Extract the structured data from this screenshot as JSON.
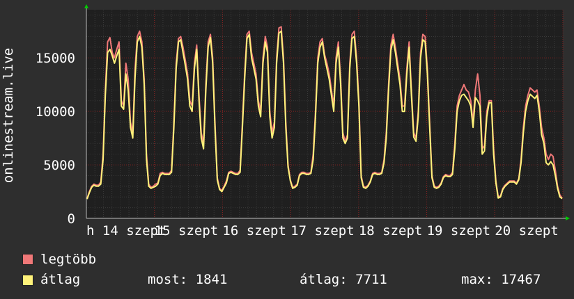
{
  "chart_data": {
    "type": "line",
    "ylabel": "onlinestream.live",
    "ylim": [
      0,
      19500
    ],
    "yticks": [
      0,
      5000,
      10000,
      15000
    ],
    "x_tick_labels": [
      "h 14 szept",
      "15 szept",
      "16 szept",
      "17 szept",
      "18 szept",
      "19 szept",
      "20 szept"
    ],
    "grid": true,
    "colors": {
      "background": "#2e2e2e",
      "plot": "#1f1f1f",
      "grid": "#3a3a3a",
      "major_grid": "#8a2020",
      "max": "#f07878",
      "avg": "#fff27a",
      "axis_arrow": "#00cc00"
    },
    "series": [
      {
        "name": "legtöbb",
        "color": "#f07878",
        "values": [
          1850,
          2500,
          3000,
          3200,
          3100,
          3100,
          3400,
          6000,
          12000,
          16500,
          16900,
          15500,
          15000,
          15800,
          16500,
          11000,
          10500,
          14500,
          13000,
          9000,
          8000,
          14000,
          17000,
          17500,
          16500,
          13000,
          6000,
          3200,
          2900,
          3000,
          3200,
          3300,
          4200,
          4300,
          4200,
          4200,
          4200,
          4500,
          9000,
          14500,
          16800,
          17000,
          16000,
          14800,
          13500,
          11000,
          10500,
          14500,
          16200,
          11500,
          8000,
          7000,
          12500,
          16500,
          17200,
          15000,
          9000,
          3800,
          2800,
          2600,
          3000,
          3500,
          4300,
          4400,
          4300,
          4200,
          4200,
          4500,
          9000,
          13500,
          17200,
          17500,
          15500,
          14500,
          13500,
          11000,
          10000,
          15000,
          17000,
          16000,
          10000,
          8000,
          9000,
          15000,
          17800,
          17900,
          15000,
          9000,
          5000,
          3600,
          2900,
          3000,
          3200,
          4100,
          4300,
          4300,
          4200,
          4200,
          4300,
          6000,
          10000,
          15000,
          16500,
          16800,
          15300,
          14500,
          13500,
          12000,
          10500,
          15000,
          16500,
          13000,
          8000,
          7200,
          7800,
          14500,
          17200,
          17500,
          15000,
          11000,
          4000,
          3000,
          2900,
          3100,
          3500,
          4200,
          4300,
          4200,
          4200,
          4300,
          5500,
          8000,
          12500,
          16200,
          17200,
          16000,
          14500,
          13000,
          10500,
          10500,
          14000,
          16500,
          12000,
          8000,
          7500,
          10000,
          15500,
          17200,
          17000,
          14000,
          9000,
          4000,
          3000,
          2900,
          3000,
          3300,
          3900,
          4100,
          4000,
          4000,
          4300,
          7000,
          10500,
          11500,
          12000,
          12500,
          12000,
          11800,
          11000,
          9000,
          12000,
          13500,
          11500,
          6500,
          6800,
          10000,
          11000,
          11000,
          6500,
          3500,
          2000,
          2100,
          2800,
          3100,
          3300,
          3500,
          3500,
          3500,
          3300,
          3700,
          5500,
          8500,
          10500,
          11500,
          12200,
          12000,
          11800,
          12000,
          10500,
          8500,
          7500,
          6000,
          5500,
          6000,
          5800,
          4500,
          3000,
          2200,
          1900
        ],
        "linewidth": 2
      },
      {
        "name": "átlag",
        "color": "#fff27a",
        "values": [
          1800,
          2400,
          2900,
          3100,
          3000,
          3000,
          3200,
          5500,
          11500,
          15500,
          15800,
          15200,
          14500,
          15200,
          15800,
          10500,
          10200,
          13500,
          12000,
          8500,
          7500,
          13200,
          16500,
          17000,
          16000,
          12500,
          5500,
          3000,
          2800,
          2900,
          3000,
          3200,
          4000,
          4200,
          4100,
          4100,
          4100,
          4300,
          8500,
          14000,
          16500,
          16700,
          15500,
          14300,
          13000,
          10500,
          10000,
          14000,
          15800,
          11000,
          7500,
          6500,
          12000,
          16000,
          16900,
          14500,
          8500,
          3600,
          2700,
          2500,
          2900,
          3300,
          4200,
          4300,
          4200,
          4100,
          4100,
          4300,
          8500,
          13000,
          16800,
          17200,
          15000,
          14000,
          13000,
          10500,
          9500,
          14500,
          16500,
          15500,
          9500,
          7500,
          8500,
          14500,
          17300,
          17500,
          14500,
          8500,
          4800,
          3500,
          2800,
          2900,
          3100,
          4000,
          4200,
          4200,
          4100,
          4100,
          4200,
          5500,
          9500,
          14500,
          16000,
          16500,
          15000,
          14000,
          13000,
          11500,
          10000,
          14500,
          16000,
          12500,
          7500,
          7000,
          7500,
          14000,
          16800,
          17000,
          14500,
          10500,
          3800,
          2900,
          2800,
          3000,
          3400,
          4100,
          4200,
          4100,
          4100,
          4200,
          5200,
          7500,
          12000,
          15700,
          16700,
          15500,
          14000,
          12500,
          10000,
          10000,
          13500,
          16000,
          11500,
          7600,
          7200,
          9500,
          15000,
          16700,
          16500,
          13500,
          8500,
          3800,
          2900,
          2800,
          2900,
          3200,
          3800,
          4000,
          3900,
          3900,
          4100,
          6500,
          10000,
          11000,
          11500,
          11600,
          11300,
          11000,
          10500,
          8500,
          11300,
          11000,
          10500,
          6000,
          6300,
          9500,
          10800,
          10800,
          6000,
          3300,
          1900,
          2000,
          2700,
          3000,
          3200,
          3400,
          3400,
          3400,
          3200,
          3600,
          5200,
          8000,
          10000,
          11000,
          11600,
          11400,
          11200,
          11500,
          10000,
          7800,
          7000,
          5200,
          5000,
          5300,
          5000,
          4000,
          2800,
          2000,
          1841
        ],
        "linewidth": 2
      }
    ],
    "legend": [
      {
        "label": "legtöbb",
        "color": "#f07878"
      },
      {
        "label": "átlag",
        "color": "#fff27a"
      }
    ],
    "stats": {
      "most": "most: 1841",
      "atlag": "átlag: 7711",
      "max": "max: 17467"
    }
  }
}
